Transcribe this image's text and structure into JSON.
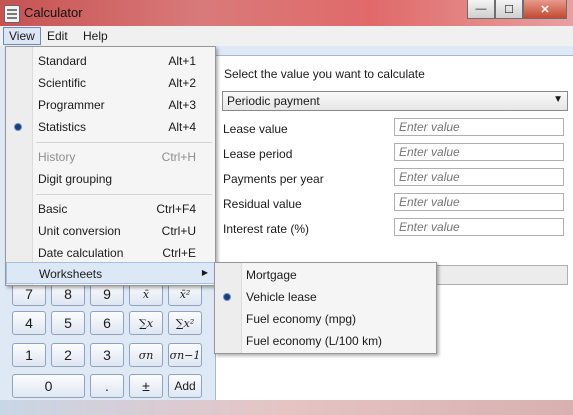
{
  "window": {
    "title": "Calculator",
    "minimize_label": "—",
    "maximize_label": "☐",
    "close_label": "✕"
  },
  "menubar": {
    "view": "View",
    "edit": "Edit",
    "help": "Help"
  },
  "view_menu": {
    "items": [
      {
        "label": "Standard",
        "shortcut": "Alt+1"
      },
      {
        "label": "Scientific",
        "shortcut": "Alt+2"
      },
      {
        "label": "Programmer",
        "shortcut": "Alt+3"
      },
      {
        "label": "Statistics",
        "shortcut": "Alt+4",
        "checked": true
      },
      {
        "label": "History",
        "shortcut": "Ctrl+H",
        "disabled": true
      },
      {
        "label": "Digit grouping",
        "shortcut": ""
      },
      {
        "label": "Basic",
        "shortcut": "Ctrl+F4"
      },
      {
        "label": "Unit conversion",
        "shortcut": "Ctrl+U"
      },
      {
        "label": "Date calculation",
        "shortcut": "Ctrl+E"
      },
      {
        "label": "Worksheets",
        "shortcut": "",
        "submenu": true
      }
    ]
  },
  "worksheets_menu": {
    "items": [
      {
        "label": "Mortgage"
      },
      {
        "label": "Vehicle lease",
        "checked": true
      },
      {
        "label": "Fuel economy (mpg)"
      },
      {
        "label": "Fuel economy (L/100 km)"
      }
    ]
  },
  "worksheet": {
    "prompt": "Select the value you want to calculate",
    "selected": "Periodic payment",
    "fields": [
      {
        "label": "Lease value",
        "placeholder": "Enter value"
      },
      {
        "label": "Lease period",
        "placeholder": "Enter value"
      },
      {
        "label": "Payments per year",
        "placeholder": "Enter value"
      },
      {
        "label": "Residual value",
        "placeholder": "Enter value"
      },
      {
        "label": "Interest rate (%)",
        "placeholder": "Enter value"
      }
    ]
  },
  "keypad": {
    "row1": [
      "7",
      "8",
      "9",
      "x̄",
      "x̄²"
    ],
    "row2": [
      "4",
      "5",
      "6",
      "∑x",
      "∑x²"
    ],
    "row3": [
      "1",
      "2",
      "3",
      "σn",
      "σn−1"
    ],
    "row4": [
      "0",
      ".",
      "±",
      "Add"
    ]
  },
  "colors": {
    "title_bar": "#c75252",
    "menu_highlight": "#dde8f6",
    "radio": "#1b3e7a"
  }
}
